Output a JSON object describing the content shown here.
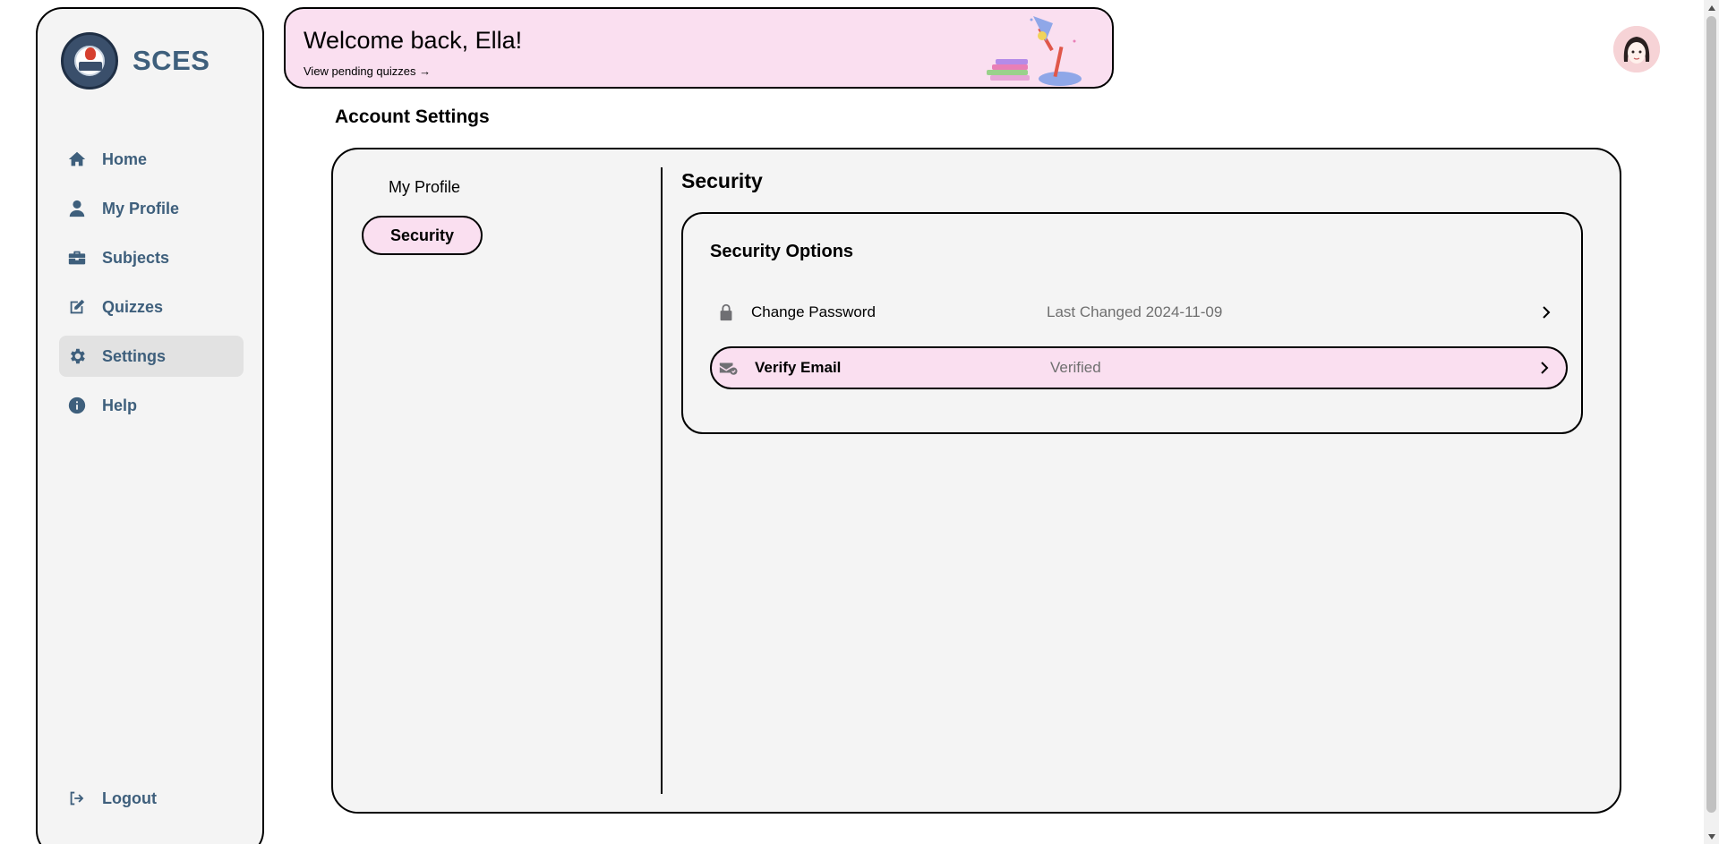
{
  "brand": {
    "name": "SCES"
  },
  "sidebar": {
    "items": [
      {
        "label": "Home",
        "icon": "home-icon"
      },
      {
        "label": "My Profile",
        "icon": "user-icon"
      },
      {
        "label": "Subjects",
        "icon": "briefcase-icon"
      },
      {
        "label": "Quizzes",
        "icon": "edit-icon"
      },
      {
        "label": "Settings",
        "icon": "gear-icon",
        "active": true
      },
      {
        "label": "Help",
        "icon": "info-icon"
      }
    ],
    "logout_label": "Logout"
  },
  "banner": {
    "title": "Welcome back, Ella!",
    "link": "View pending quizzes →"
  },
  "page": {
    "title": "Account Settings"
  },
  "settings_nav": {
    "items": [
      {
        "label": "My Profile"
      },
      {
        "label": "Security",
        "active": true
      }
    ]
  },
  "security": {
    "title": "Security",
    "options_title": "Security Options",
    "rows": [
      {
        "label": "Change Password",
        "value": "Last Changed 2024-11-09",
        "icon": "lock-icon"
      },
      {
        "label": "Verify Email",
        "value": "Verified",
        "icon": "mail-check-icon",
        "highlighted": true
      }
    ]
  },
  "colors": {
    "accent_pink": "#fadff0",
    "nav_text": "#3e5f7c",
    "panel_bg": "#f4f4f4"
  }
}
